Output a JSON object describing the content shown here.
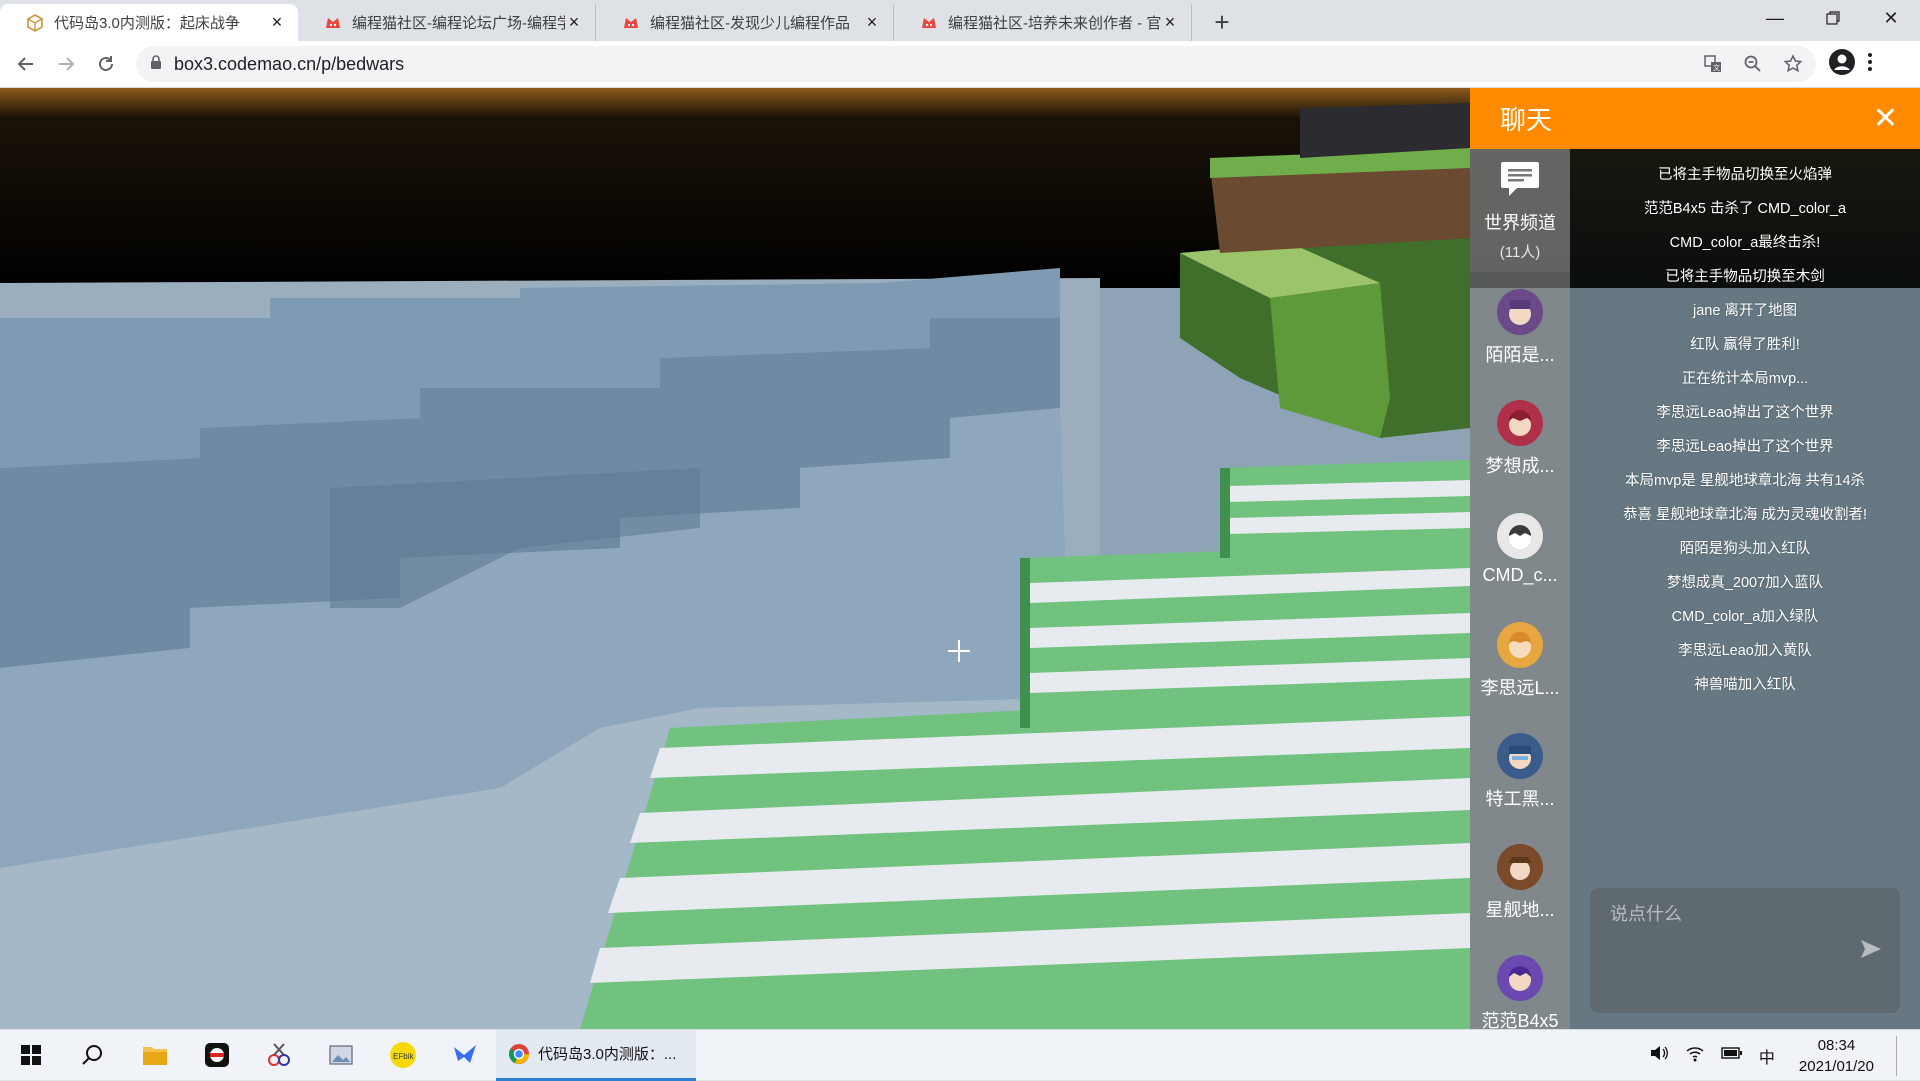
{
  "browser": {
    "tabs": [
      {
        "title": "代码岛3.0内测版：起床战争",
        "active": true,
        "favicon": "box-icon"
      },
      {
        "title": "编程猫社区-编程论坛广场-编程学",
        "active": false,
        "favicon": "codemao-icon"
      },
      {
        "title": "编程猫社区-发现少儿编程作品",
        "active": false,
        "favicon": "codemao-icon"
      },
      {
        "title": "编程猫社区-培养未来创作者 - 官",
        "active": false,
        "favicon": "codemao-icon"
      }
    ],
    "url": "box3.codemao.cn/p/bedwars"
  },
  "chat": {
    "title": "聊天",
    "world_channel": {
      "name": "世界频道",
      "count": "(11人)"
    },
    "players": [
      {
        "name": "陌陌是...",
        "avatar_color": "#6b4a8a"
      },
      {
        "name": "梦想成...",
        "avatar_color": "#b0304a"
      },
      {
        "name": "CMD_c...",
        "avatar_color": "#e8e8e8"
      },
      {
        "name": "李思远L...",
        "avatar_color": "#e8a640"
      },
      {
        "name": "特工黑...",
        "avatar_color": "#3b5c8a"
      },
      {
        "name": "星舰地...",
        "avatar_color": "#7a4a2a"
      },
      {
        "name": "范范B4x5",
        "avatar_color": "#6a4ab0"
      }
    ],
    "messages": [
      "已将主手物品切换至火焰弹",
      "范范B4x5 击杀了 CMD_color_a",
      "CMD_color_a最终击杀!",
      "已将主手物品切换至木剑",
      "jane 离开了地图",
      "红队 赢得了胜利!",
      "正在统计本局mvp...",
      "李思远Leao掉出了这个世界",
      "李思远Leao掉出了这个世界",
      "本局mvp是 星舰地球章北海 共有14杀",
      "恭喜 星舰地球章北海 成为灵魂收割者!",
      "陌陌是狗头加入红队",
      "梦想成真_2007加入蓝队",
      "CMD_color_a加入绿队",
      "李思远Leao加入黄队",
      "神兽喵加入红队"
    ],
    "input_placeholder": "说点什么",
    "accent_color": "#ff8a00"
  },
  "taskbar": {
    "chrome_task": "代码岛3.0内测版：...",
    "ime": "中",
    "time": "08:34",
    "date": "2021/01/20"
  }
}
